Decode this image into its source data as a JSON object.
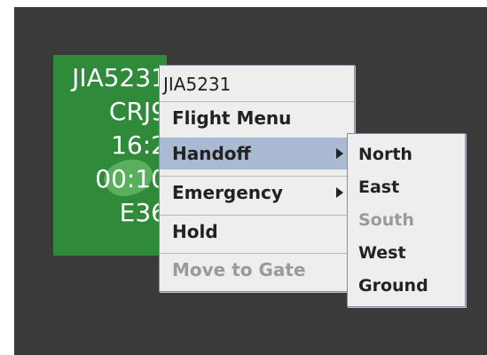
{
  "target_block": {
    "lines": [
      "JIA5231",
      "CRJ9",
      "16:2",
      "00:10",
      "E36"
    ]
  },
  "flight_menu": {
    "title": "JIA5231",
    "items": [
      {
        "label": "Flight Menu",
        "has_submenu": false,
        "enabled": true
      },
      {
        "label": "Handoff",
        "has_submenu": true,
        "enabled": true,
        "selected": true
      },
      {
        "label": "Emergency",
        "has_submenu": true,
        "enabled": true
      },
      {
        "label": "Hold",
        "has_submenu": false,
        "enabled": true
      },
      {
        "label": "Move to Gate",
        "has_submenu": false,
        "enabled": false
      }
    ]
  },
  "handoff_submenu": {
    "items": [
      {
        "label": "North",
        "enabled": true
      },
      {
        "label": "East",
        "enabled": true
      },
      {
        "label": "South",
        "enabled": false
      },
      {
        "label": "West",
        "enabled": true
      },
      {
        "label": "Ground",
        "enabled": true
      }
    ]
  },
  "colors": {
    "scope_background": "#3a3a3a",
    "target_green": "#2f8a3a",
    "menu_background": "#eeeeee",
    "menu_selected": "#a9bad2",
    "menu_disabled_text": "#9a9a9a"
  }
}
